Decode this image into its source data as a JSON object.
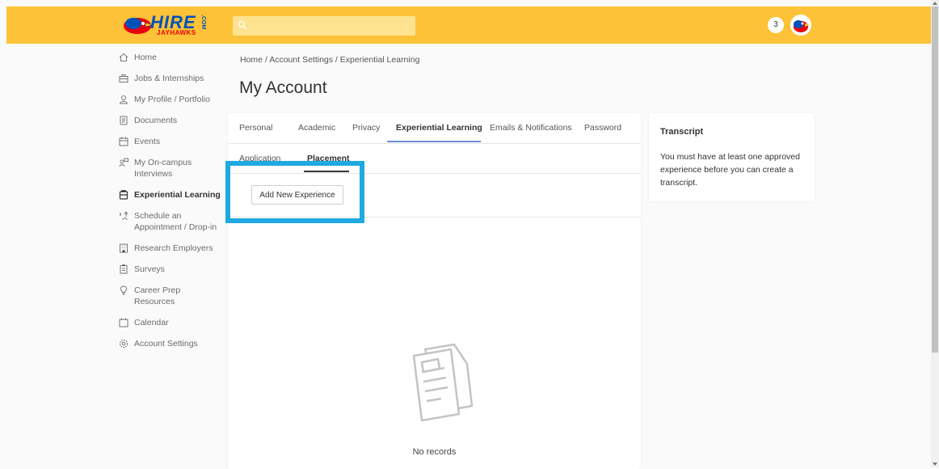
{
  "header": {
    "logo": {
      "brand": "HIRE",
      "sub": "JAYHAWKS",
      "tld": ".COM"
    },
    "search": {
      "placeholder": ""
    },
    "notification_count": "3"
  },
  "sidebar": {
    "items": [
      {
        "label": "Home",
        "icon": "home-icon"
      },
      {
        "label": "Jobs & Internships",
        "icon": "briefcase-icon"
      },
      {
        "label": "My Profile / Portfolio",
        "icon": "profile-icon"
      },
      {
        "label": "Documents",
        "icon": "documents-icon"
      },
      {
        "label": "Events",
        "icon": "events-icon"
      },
      {
        "label": "My On-campus Interviews",
        "icon": "interviews-icon"
      },
      {
        "label": "Experiential Learning",
        "icon": "experiential-learning-icon",
        "active": true
      },
      {
        "label": "Schedule an Appointment / Drop-in",
        "icon": "appointment-icon"
      },
      {
        "label": "Research Employers",
        "icon": "employers-icon"
      },
      {
        "label": "Surveys",
        "icon": "surveys-icon"
      },
      {
        "label": "Career Prep Resources",
        "icon": "lightbulb-icon"
      },
      {
        "label": "Calendar",
        "icon": "calendar-icon"
      },
      {
        "label": "Account Settings",
        "icon": "gear-icon"
      }
    ]
  },
  "breadcrumb": {
    "items": [
      "Home",
      "Account Settings",
      "Experiential Learning"
    ],
    "separator": "/"
  },
  "page_title": "My Account",
  "tabs": [
    "Personal",
    "Academic",
    "Privacy",
    "Experiential Learning",
    "Emails & Notifications",
    "Password"
  ],
  "active_tab": "Experiential Learning",
  "subtabs": [
    "Application",
    "Placement"
  ],
  "active_subtab": "Placement",
  "add_button_label": "Add New Experience",
  "empty_text": "No records",
  "transcript": {
    "title": "Transcript",
    "body": "You must have at least one approved experience before you can create a transcript."
  },
  "colors": {
    "header": "#fdc237",
    "highlight": "#1fa9e1",
    "tab_indicator": "#6b8fd6"
  }
}
